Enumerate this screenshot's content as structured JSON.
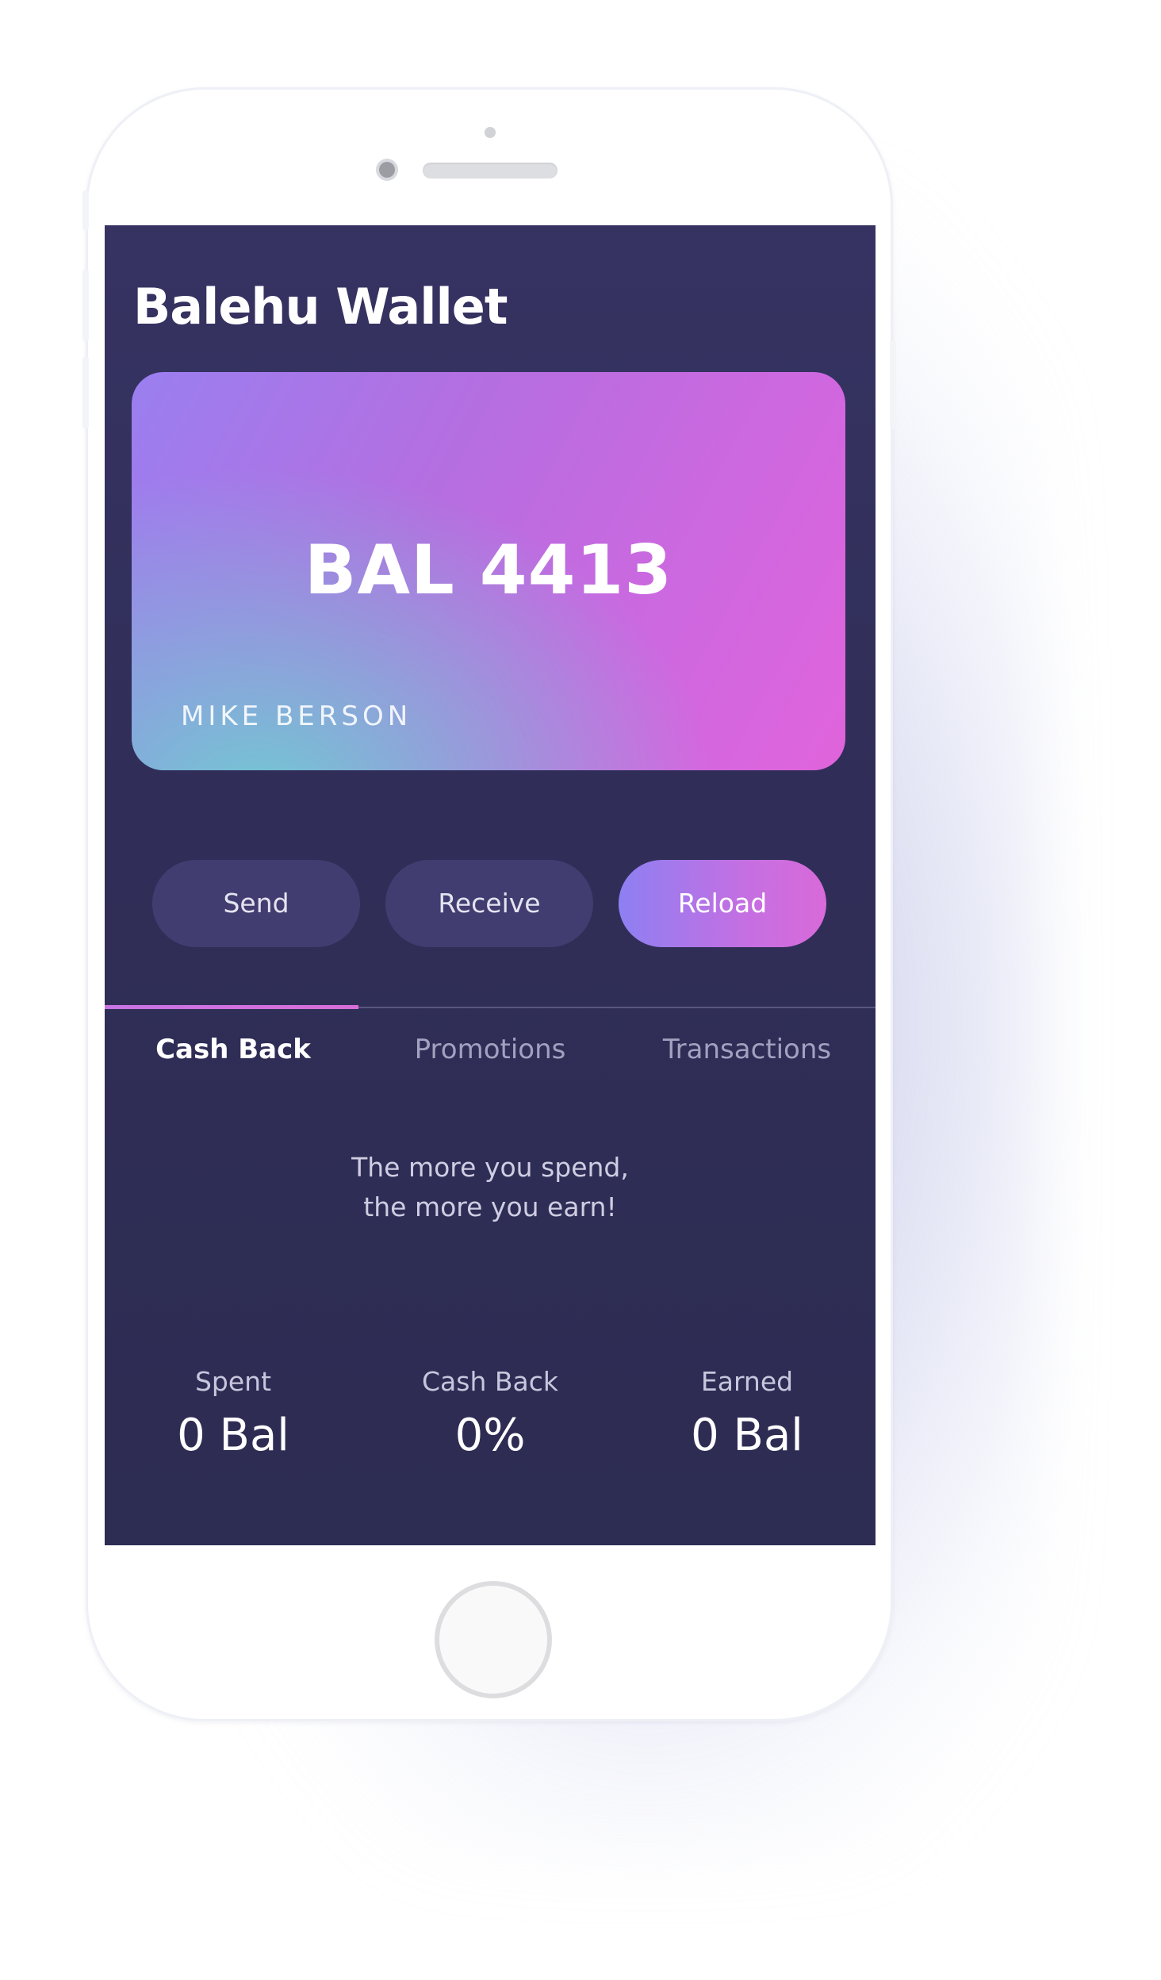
{
  "app": {
    "title": "Balehu Wallet"
  },
  "card": {
    "balance": "BAL 4413",
    "holder": "MIKE BERSON"
  },
  "actions": {
    "send_label": "Send",
    "receive_label": "Receive",
    "reload_label": "Reload"
  },
  "tabs": [
    {
      "label": "Cash Back",
      "active": true
    },
    {
      "label": "Promotions",
      "active": false
    },
    {
      "label": "Transactions",
      "active": false
    }
  ],
  "cashback": {
    "message_line1": "The more you spend,",
    "message_line2": "the more you earn!",
    "stats": [
      {
        "label": "Spent",
        "value": "0 Bal"
      },
      {
        "label": "Cash Back",
        "value": "0%"
      },
      {
        "label": "Earned",
        "value": "0 Bal"
      }
    ]
  },
  "colors": {
    "screen_background": "#302e58",
    "accent_pink": "#d96ad9",
    "accent_purple": "#8d80f2",
    "button_dark": "#413d70"
  }
}
